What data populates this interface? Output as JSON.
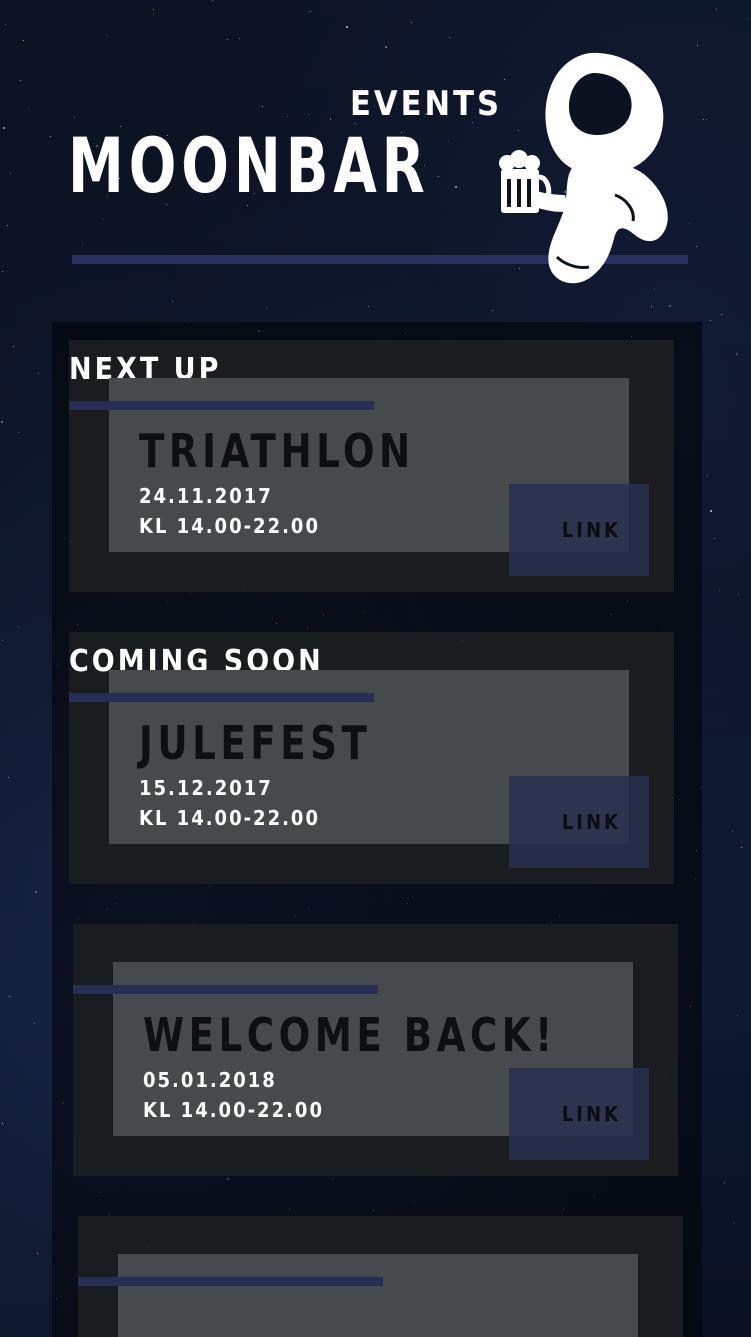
{
  "header": {
    "title": "MOONBAR",
    "subtitle": "EVENTS",
    "mascot_icon": "astronaut-with-beer-icon"
  },
  "events": [
    {
      "section": "NEXT UP",
      "name": "TRIATHLON",
      "date": "24.11.2017",
      "time": "KL 14.00-22.00",
      "link": "LINK"
    },
    {
      "section": "COMING SOON",
      "name": "JULEFEST",
      "date": "15.12.2017",
      "time": "KL 14.00-22.00",
      "link": "LINK"
    },
    {
      "section": "",
      "name": "WELCOME BACK!",
      "date": "05.01.2018",
      "time": "KL 14.00-22.00",
      "link": "LINK"
    }
  ],
  "colors": {
    "background": "#0b1220",
    "accent_bar": "#27305f",
    "card": "#474a4d",
    "event_panel": "#1c1e21"
  }
}
